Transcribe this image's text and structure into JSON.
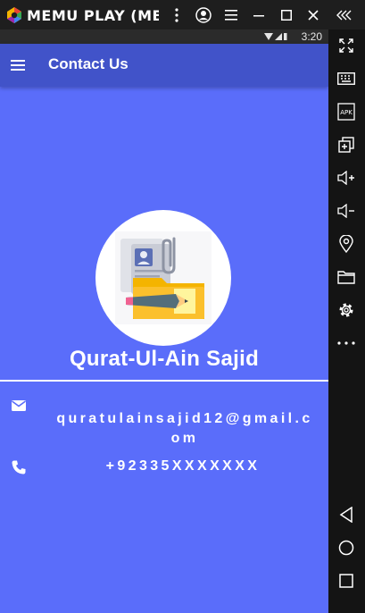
{
  "window": {
    "title": "MEMU PLAY (ME",
    "logo_icon": "memu-logo-icon",
    "buttons": [
      "more-icon",
      "account-icon",
      "menu-icon",
      "minimize-icon",
      "maximize-icon",
      "close-icon",
      "collapse-icon"
    ]
  },
  "sidebar": {
    "tools": [
      "fullscreen-icon",
      "keyboard-icon",
      "apk-icon",
      "multi-window-icon",
      "volume-up-icon",
      "volume-down-icon",
      "location-icon",
      "folder-icon",
      "settings-icon",
      "more-dots-icon"
    ],
    "apk_label": "APK",
    "nav": [
      "back-icon",
      "home-icon",
      "recents-icon"
    ]
  },
  "status_bar": {
    "time": "3:20"
  },
  "app_bar": {
    "title": "Contact Us"
  },
  "profile": {
    "name": "Qurat-Ul-Ain Sajid",
    "email": "quratulainsajid12@gmail.com",
    "phone": "+92335XXXXXXX"
  },
  "colors": {
    "screen_bg": "#5a6dfa",
    "app_bar": "#4153c9",
    "status_bar": "#2b2b2b",
    "text": "#ffffff"
  }
}
